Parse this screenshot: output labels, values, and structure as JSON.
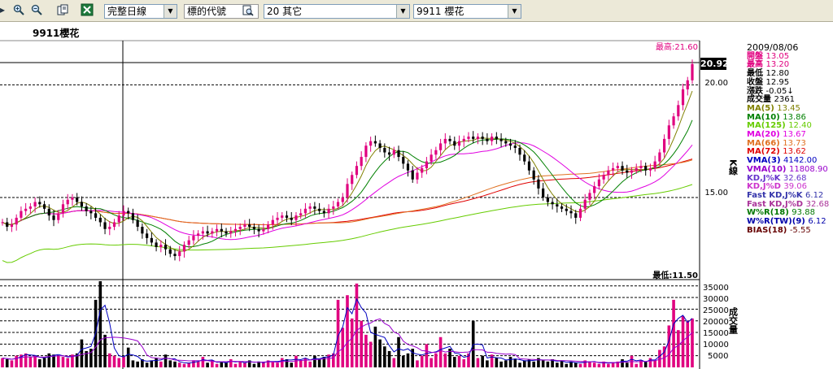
{
  "toolbar": {
    "period_select": "完整日線",
    "code_label": "標的代號",
    "category_select": "20 其它",
    "stock_select": "9911 櫻花"
  },
  "stock_title": "9911櫻花",
  "price_axis": {
    "ticks": [
      "20.00",
      "15.00"
    ],
    "label": "K線",
    "high_label": "最高:21.60",
    "low_label": "最低:11.50",
    "current_price": "20.92"
  },
  "volume_axis": {
    "ticks": [
      "35000",
      "30000",
      "25000",
      "20000",
      "15000",
      "10000",
      "5000"
    ],
    "label": "成交量"
  },
  "info": {
    "date": "2009/08/06",
    "rows": [
      {
        "label": "開盤",
        "value": "13.05",
        "color": "#E0007F"
      },
      {
        "label": "最高",
        "value": "13.20",
        "color": "#E0007F"
      },
      {
        "label": "最低",
        "value": "12.80",
        "color": "#000000"
      },
      {
        "label": "收盤",
        "value": "12.95",
        "color": "#000000"
      },
      {
        "label": "漲跌",
        "value": "-0.05↓",
        "color": "#000000"
      },
      {
        "label": "成交量",
        "value": "2361",
        "color": "#000000"
      },
      {
        "label": "MA(5)",
        "value": "13.45",
        "color": "#808000"
      },
      {
        "label": "MA(10)",
        "value": "13.86",
        "color": "#008000"
      },
      {
        "label": "MA(125)",
        "value": "12.40",
        "color": "#66CC00"
      },
      {
        "label": "MA(20)",
        "value": "13.67",
        "color": "#E000E0"
      },
      {
        "label": "MA(66)",
        "value": "13.73",
        "color": "#E07020"
      },
      {
        "label": "MA(72)",
        "value": "13.62",
        "color": "#E00000"
      },
      {
        "label": "VMA(3)",
        "value": "4142.00",
        "color": "#0000C0"
      },
      {
        "label": "VMA(10)",
        "value": "11808.90",
        "color": "#9900CC"
      },
      {
        "label": "KD,J%K",
        "value": "32.68",
        "color": "#6633CC"
      },
      {
        "label": "KD,J%D",
        "value": "39.06",
        "color": "#CC33CC"
      },
      {
        "label": "Fast KD,J%K",
        "value": "6.12",
        "color": "#3333AA"
      },
      {
        "label": "Fast KD,J%D",
        "value": "32.68",
        "color": "#AA3399"
      },
      {
        "label": "W%R(18)",
        "value": "93.88",
        "color": "#007700"
      },
      {
        "label": "W%R(TW)(9)",
        "value": "6.12",
        "color": "#0000AA"
      },
      {
        "label": "BIAS(18)",
        "value": "-5.55",
        "color": "#660000"
      }
    ]
  },
  "colors": {
    "up": "#E0007F",
    "down": "#000000",
    "ma5": "#808000",
    "ma10": "#008000",
    "ma125": "#66CC00",
    "ma20": "#E000E0",
    "ma66": "#E07020",
    "ma72": "#E00000",
    "vma3": "#0000C0",
    "vma10": "#9900CC"
  },
  "chart_data": {
    "type": "candlestick",
    "price_ylim": [
      11.5,
      21.6
    ],
    "volume_ylim": [
      0,
      37000
    ],
    "close": [
      13.9,
      13.7,
      13.8,
      14.1,
      14.4,
      14.5,
      14.6,
      14.8,
      14.7,
      14.5,
      14.2,
      14.0,
      14.3,
      14.7,
      14.9,
      15.0,
      14.8,
      14.6,
      14.4,
      14.3,
      14.1,
      13.9,
      13.6,
      13.7,
      13.9,
      14.2,
      14.4,
      14.3,
      14.0,
      13.7,
      13.4,
      13.2,
      13.0,
      12.8,
      12.9,
      12.7,
      12.5,
      12.4,
      12.6,
      12.9,
      13.1,
      13.3,
      13.4,
      13.5,
      13.4,
      13.5,
      13.6,
      13.5,
      13.4,
      13.5,
      13.6,
      13.7,
      13.8,
      13.7,
      13.6,
      13.5,
      13.6,
      13.8,
      14.0,
      14.1,
      14.2,
      14.1,
      14.0,
      14.2,
      14.3,
      14.5,
      14.6,
      14.5,
      14.4,
      14.3,
      14.5,
      14.6,
      14.8,
      15.0,
      15.6,
      16.0,
      16.4,
      16.8,
      17.3,
      17.5,
      17.4,
      17.2,
      17.0,
      16.9,
      17.1,
      16.8,
      16.5,
      16.2,
      15.8,
      16.1,
      16.3,
      16.6,
      16.9,
      17.1,
      17.4,
      17.6,
      17.5,
      17.3,
      17.5,
      17.6,
      17.7,
      17.6,
      17.7,
      17.6,
      17.5,
      17.7,
      17.6,
      17.5,
      17.4,
      17.3,
      17.2,
      16.9,
      16.6,
      16.2,
      15.8,
      15.4,
      15.0,
      14.8,
      14.7,
      14.6,
      14.5,
      14.4,
      14.3,
      14.1,
      14.5,
      14.9,
      15.2,
      15.5,
      15.8,
      16.0,
      16.2,
      16.3,
      16.4,
      16.2,
      16.1,
      16.2,
      16.3,
      16.4,
      16.2,
      16.3,
      16.6,
      17.0,
      17.6,
      18.2,
      18.6,
      19.1,
      19.8,
      20.2,
      20.92
    ],
    "volume": [
      4000,
      3500,
      3000,
      5000,
      5500,
      6000,
      4500,
      5000,
      3500,
      4000,
      6000,
      5500,
      5000,
      4500,
      4000,
      5500,
      6000,
      12000,
      7000,
      8000,
      29000,
      37000,
      14000,
      6000,
      5000,
      4000,
      4500,
      8500,
      3000,
      2500,
      3500,
      2000,
      3000,
      4000,
      2500,
      5500,
      3000,
      2500,
      2000,
      1500,
      2000,
      3000,
      2500,
      4500,
      2000,
      3000,
      1500,
      2500,
      2000,
      3500,
      1500,
      2500,
      2000,
      3000,
      1500,
      2500,
      2000,
      3000,
      2500,
      2000,
      4000,
      3500,
      2000,
      5000,
      3000,
      4000,
      2500,
      5000,
      3500,
      4500,
      5500,
      6000,
      29000,
      17000,
      31000,
      21000,
      36000,
      20000,
      14000,
      11000,
      17500,
      12000,
      9000,
      7000,
      4000,
      13000,
      5000,
      6000,
      8000,
      3000,
      5000,
      10000,
      4000,
      6000,
      13000,
      6000,
      8000,
      4500,
      5000,
      3500,
      6000,
      20000,
      4000,
      5000,
      3000,
      5500,
      4000,
      2500,
      3000,
      4500,
      3500,
      2000,
      3000,
      3500,
      2500,
      4000,
      3000,
      2500,
      3500,
      2000,
      3000,
      1500,
      2500,
      2000,
      1500,
      3000,
      2500,
      2000,
      1500,
      2500,
      1500,
      2000,
      2500,
      3500,
      2000,
      5000,
      1500,
      3000,
      2500,
      4000,
      3000,
      7500,
      9000,
      18000,
      29000,
      16000,
      22000,
      20000,
      21000
    ]
  }
}
